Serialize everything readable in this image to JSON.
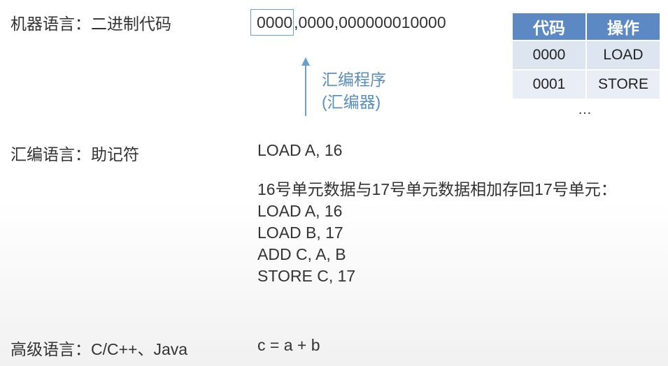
{
  "machine": {
    "label": "机器语言：二进制代码",
    "code_boxed": "0000",
    "code_rest": ",0000,000000010000"
  },
  "assembler_note": {
    "line1": "汇编程序",
    "line2": "(汇编器)"
  },
  "opcode_table": {
    "headers": [
      "代码",
      "操作"
    ],
    "rows": [
      [
        "0000",
        "LOAD"
      ],
      [
        "0001",
        "STORE"
      ]
    ],
    "ellipsis": "…"
  },
  "assembly": {
    "label": "汇编语言：助记符",
    "instruction": "LOAD A, 16"
  },
  "example": {
    "description": "16号单元数据与17号单元数据相加存回17号单元：",
    "lines": [
      "LOAD A, 16",
      "LOAD B, 17",
      "ADD C, A, B",
      "STORE C, 17"
    ]
  },
  "high_level": {
    "label": "高级语言：C/C++、Java",
    "code": "c = a + b"
  },
  "colors": {
    "accent": "#5b8fbf",
    "table_header": "#5c88c4",
    "table_cell": "#dde5f1",
    "box_border": "#6a9fc8"
  }
}
